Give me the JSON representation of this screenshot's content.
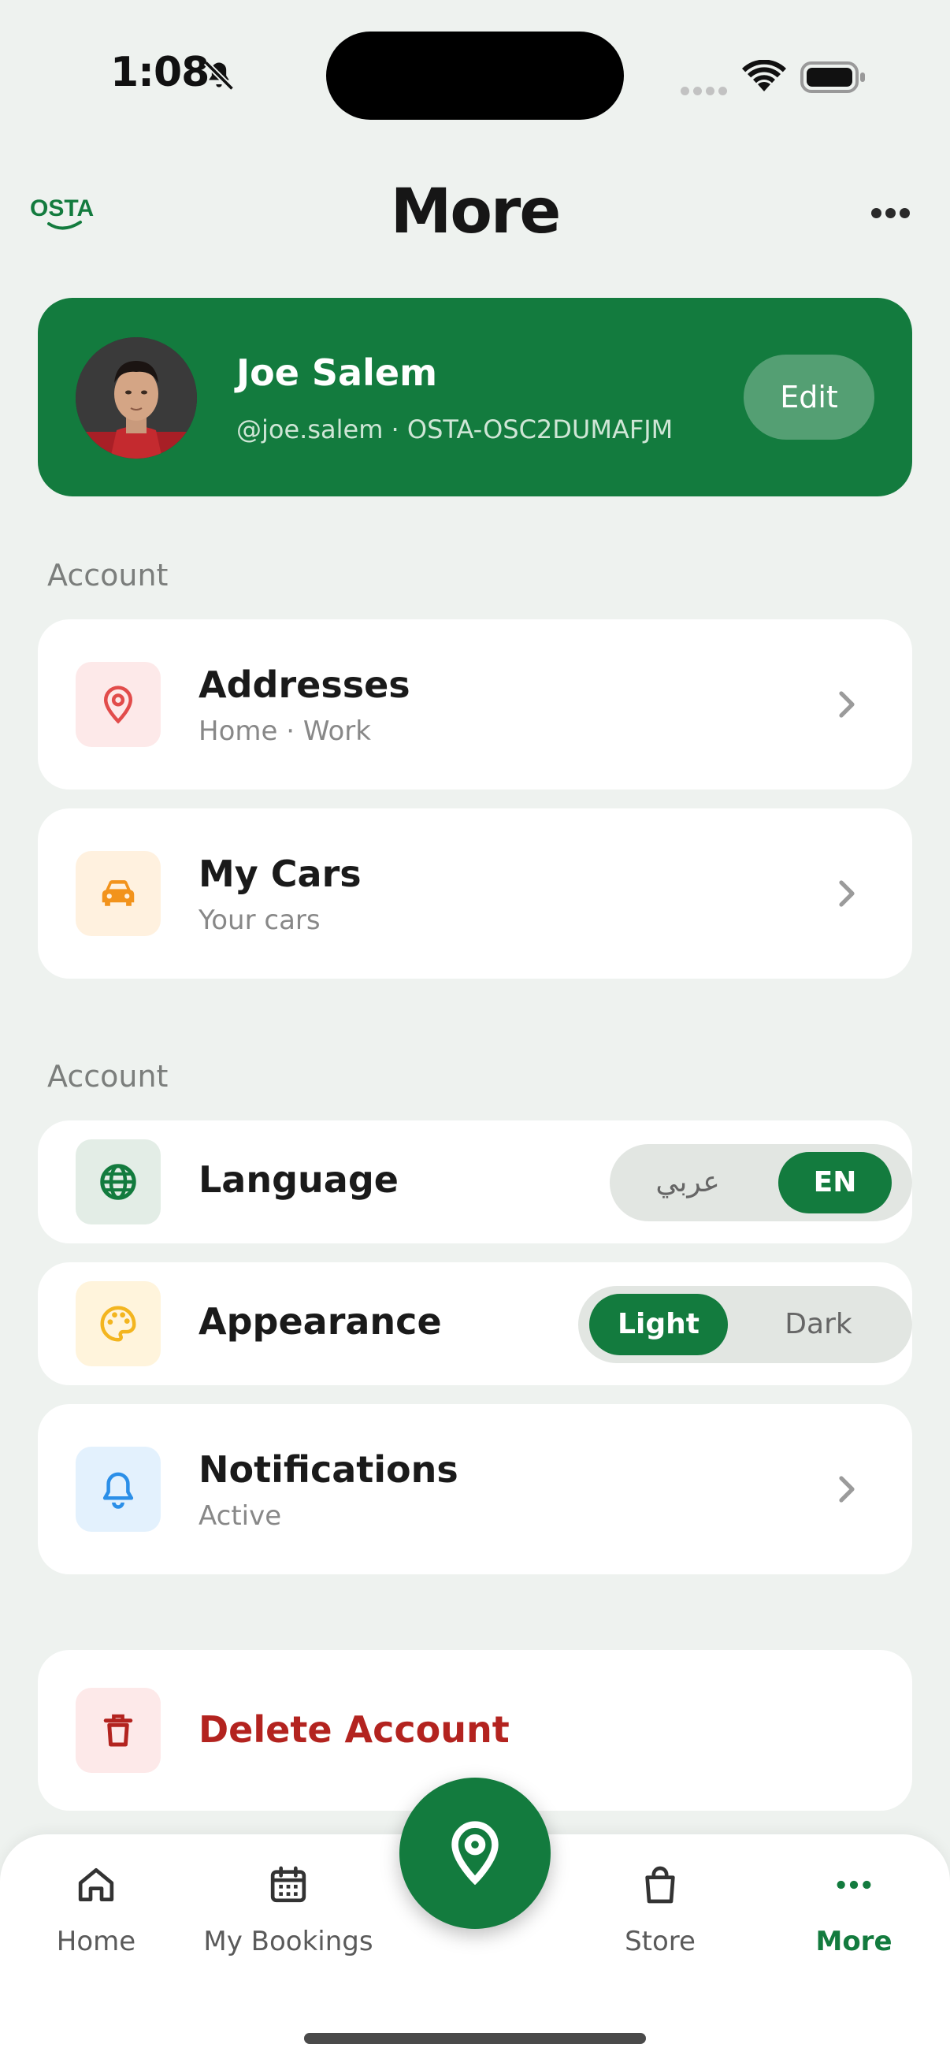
{
  "status_bar": {
    "time": "1:08"
  },
  "header": {
    "logo_text": "OSTA",
    "title": "More"
  },
  "profile": {
    "name": "Joe Salem",
    "handle_line": "@joe.salem · OSTA-OSC2DUMAFJM",
    "edit_label": "Edit"
  },
  "sections": [
    {
      "label": "Account"
    },
    {
      "label": "Account"
    }
  ],
  "account_items": [
    {
      "title": "Addresses",
      "subtitle": "Home · Work",
      "icon": "map-pin-icon",
      "icon_color": "#e24c4b",
      "icon_bg": "#fde9e9"
    },
    {
      "title": "My Cars",
      "subtitle": "Your cars",
      "icon": "car-icon",
      "icon_color": "#f2931c",
      "icon_bg": "#fff1df"
    }
  ],
  "settings": {
    "language": {
      "title": "Language",
      "options": [
        "عربي",
        "EN"
      ],
      "selected": "EN",
      "icon_color": "#137b3e",
      "icon_bg": "#e3ede6"
    },
    "appearance": {
      "title": "Appearance",
      "options": [
        "Light",
        "Dark"
      ],
      "selected": "Light",
      "icon_color": "#f3b51f",
      "icon_bg": "#fff4dc"
    },
    "notifications": {
      "title": "Notifications",
      "subtitle": "Active",
      "icon_color": "#2b8fe8",
      "icon_bg": "#e3f1fd"
    }
  },
  "danger": {
    "title": "Delete Account",
    "icon_color": "#b3231f",
    "icon_bg": "#fde9e9"
  },
  "tab_bar": {
    "tabs": [
      {
        "label": "Home",
        "icon": "home-icon"
      },
      {
        "label": "My Bookings",
        "icon": "calendar-icon"
      },
      {
        "label": "Store",
        "icon": "shopping-bag-icon"
      },
      {
        "label": "More",
        "icon": "more-dots-icon",
        "active": true
      }
    ],
    "center_action_icon": "map-pin-icon"
  },
  "colors": {
    "brand": "#137b3e",
    "danger": "#b3231f",
    "background": "#eef2ef"
  }
}
